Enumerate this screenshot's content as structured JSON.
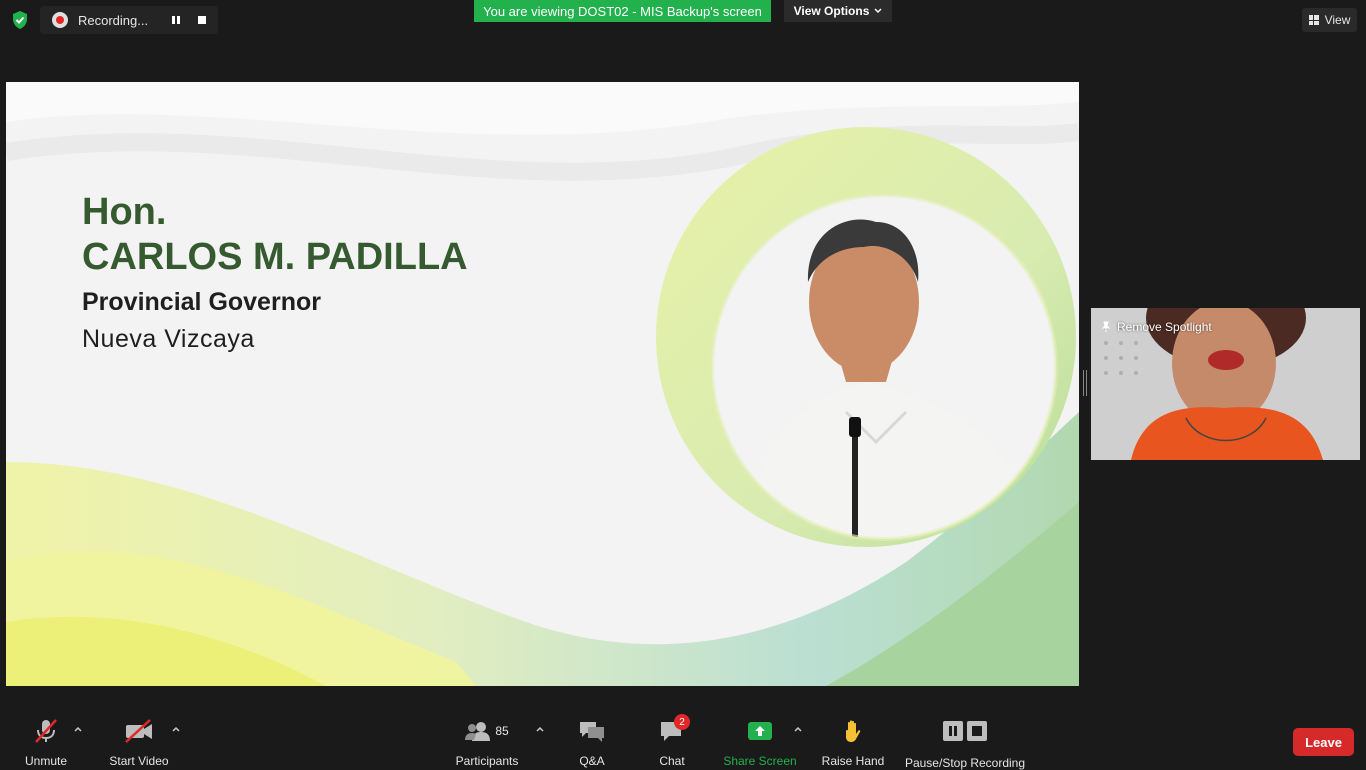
{
  "top_bar": {
    "recording_label": "Recording...",
    "viewing_banner": "You are viewing DOST02 - MIS Backup's screen",
    "view_options_label": "View Options",
    "view_label": "View"
  },
  "slide": {
    "honorific": "Hon.",
    "name": "CARLOS M. PADILLA",
    "position": "Provincial Governor",
    "province": "Nueva Vizcaya"
  },
  "video_tile": {
    "spotlight_label": "Remove Spotlight"
  },
  "toolbar": {
    "unmute_label": "Unmute",
    "start_video_label": "Start Video",
    "participants_label": "Participants",
    "participants_count": "85",
    "qa_label": "Q&A",
    "chat_label": "Chat",
    "chat_badge": "2",
    "share_screen_label": "Share Screen",
    "raise_hand_label": "Raise Hand",
    "pause_stop_label": "Pause/Stop Recording",
    "leave_label": "Leave"
  },
  "colors": {
    "share_green": "#22b14c",
    "leave_red": "#d62a2a",
    "title_green": "#365a2f"
  },
  "icons": [
    "shield-icon",
    "record-icon",
    "pause-icon",
    "stop-icon",
    "chevron-down-icon",
    "grid-icon",
    "pin-icon",
    "microphone-muted-icon",
    "video-off-icon",
    "participants-icon",
    "qa-icon",
    "chat-icon",
    "share-screen-icon",
    "raise-hand-icon"
  ]
}
